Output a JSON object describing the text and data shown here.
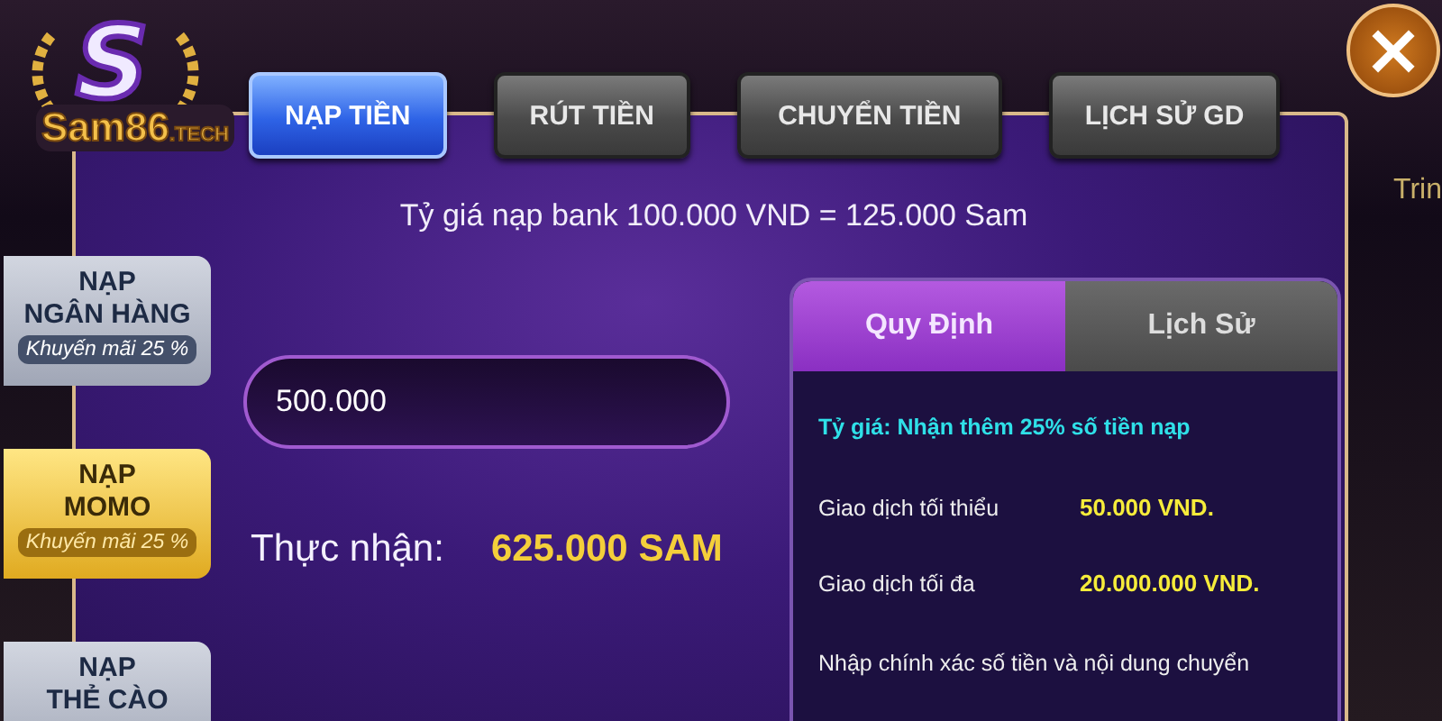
{
  "logo": {
    "letter": "S",
    "brand": "Sam86",
    "suffix": ".TECH"
  },
  "background": {
    "side_text": "Trin"
  },
  "top_tabs": [
    {
      "label": "NẠP TIỀN",
      "selected": true
    },
    {
      "label": "RÚT TIỀN",
      "selected": false
    },
    {
      "label": "CHUYỂN TIỀN",
      "selected": false
    },
    {
      "label": "LỊCH SỬ GD",
      "selected": false
    }
  ],
  "close_button": {
    "label": "×"
  },
  "rate_text": "Tỷ giá nạp bank 100.000 VND = 125.000 Sam",
  "sidebar": [
    {
      "lines": [
        "NẠP",
        "NGÂN HÀNG"
      ],
      "promo": "Khuyến mãi 25 %",
      "selected": false
    },
    {
      "lines": [
        "NẠP",
        "MOMO"
      ],
      "promo": "Khuyến mãi 25 %",
      "selected": true
    },
    {
      "lines": [
        "NẠP",
        "THẺ CÀO"
      ],
      "selected": false
    }
  ],
  "amount_field": {
    "value": "500.000"
  },
  "received": {
    "label": "Thực nhận:",
    "value": "625.000 SAM"
  },
  "info_tabs": [
    {
      "label": "Quy Định",
      "selected": true
    },
    {
      "label": "Lịch Sử",
      "selected": false
    }
  ],
  "rules": {
    "rate": "Tỷ giá: Nhận thêm 25% số tiền nạp",
    "rows": [
      {
        "label": "Giao dịch tối thiểu",
        "value": "50.000 VND."
      },
      {
        "label": "Giao dịch tối đa",
        "value": "20.000.000 VND."
      }
    ],
    "note": "Nhập chính xác số tiền và nội dung chuyển"
  }
}
